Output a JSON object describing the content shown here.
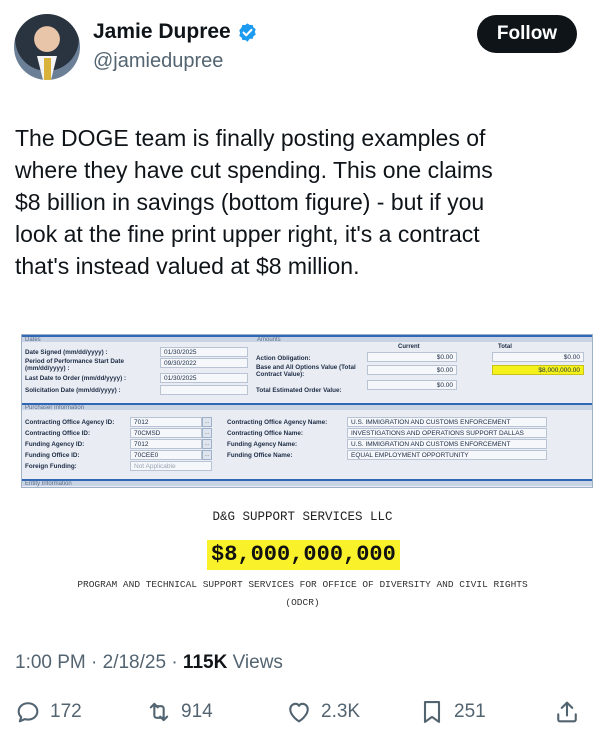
{
  "author": {
    "name": "Jamie Dupree",
    "handle": "@jamiedupree",
    "follow_label": "Follow",
    "verified_color": "#1d9bf0"
  },
  "tweet": {
    "lines": [
      "The DOGE team is finally posting examples of",
      "where they have cut spending.  This one claims",
      "$8 billion in savings (bottom figure) - but if you",
      "look at the fine print upper right, it's a contract",
      "that's instead valued at $8 million."
    ]
  },
  "media": {
    "sections": {
      "dates": "Dates",
      "amounts": "Amounts",
      "purchaser": "Purchaser Information",
      "entity": "Entity Information"
    },
    "dates": [
      {
        "label": "Date Signed (mm/dd/yyyy) :",
        "value": "01/30/2025"
      },
      {
        "label": "Period of Performance Start Date (mm/dd/yyyy) :",
        "value": "09/30/2022"
      },
      {
        "label": "Last Date to Order (mm/dd/yyyy) :",
        "value": "01/30/2025"
      },
      {
        "label": "Solicitation Date (mm/dd/yyyy) :",
        "value": ""
      }
    ],
    "amounts": {
      "col_current": "Current",
      "col_total": "Total",
      "rows": [
        {
          "label": "Action Obligation:",
          "current": "$0.00",
          "total": "$0.00"
        },
        {
          "label": "Base and All Options Value (Total Contract Value):",
          "current": "$0.00",
          "total": "$8,000,000.00"
        },
        {
          "label": "Total Estimated Order Value:",
          "current": "$0.00",
          "total": ""
        }
      ]
    },
    "purchaser_left": [
      {
        "label": "Contracting Office Agency ID:",
        "value": "7012"
      },
      {
        "label": "Contracting Office ID:",
        "value": "70CMSD"
      },
      {
        "label": "Funding Agency ID:",
        "value": "7012"
      },
      {
        "label": "Funding Office ID:",
        "value": "70CEE0"
      },
      {
        "label": "Foreign Funding:",
        "value": "Not Applicable"
      }
    ],
    "purchaser_right": [
      {
        "label": "Contracting Office Agency Name:",
        "value": "U.S. IMMIGRATION AND CUSTOMS ENFORCEMENT"
      },
      {
        "label": "Contracting Office Name:",
        "value": "INVESTIGATIONS AND OPERATIONS SUPPORT DALLAS"
      },
      {
        "label": "Funding Agency Name:",
        "value": "U.S. IMMIGRATION AND CUSTOMS ENFORCEMENT"
      },
      {
        "label": "Funding Office Name:",
        "value": "EQUAL EMPLOYMENT OPPORTUNITY"
      }
    ],
    "company": "D&G SUPPORT SERVICES LLC",
    "amount": "$8,000,000,000",
    "program_line1": "PROGRAM AND TECHNICAL SUPPORT SERVICES FOR OFFICE OF DIVERSITY AND CIVIL RIGHTS",
    "program_line2": "(ODCR)"
  },
  "meta": {
    "time": "1:00 PM · 2/18/25 · ",
    "views_count": "115K",
    "views_label": " Views"
  },
  "actions": {
    "replies": "172",
    "reposts": "914",
    "likes": "2.3K",
    "bookmarks": "251",
    "icon_color": "#536471"
  }
}
